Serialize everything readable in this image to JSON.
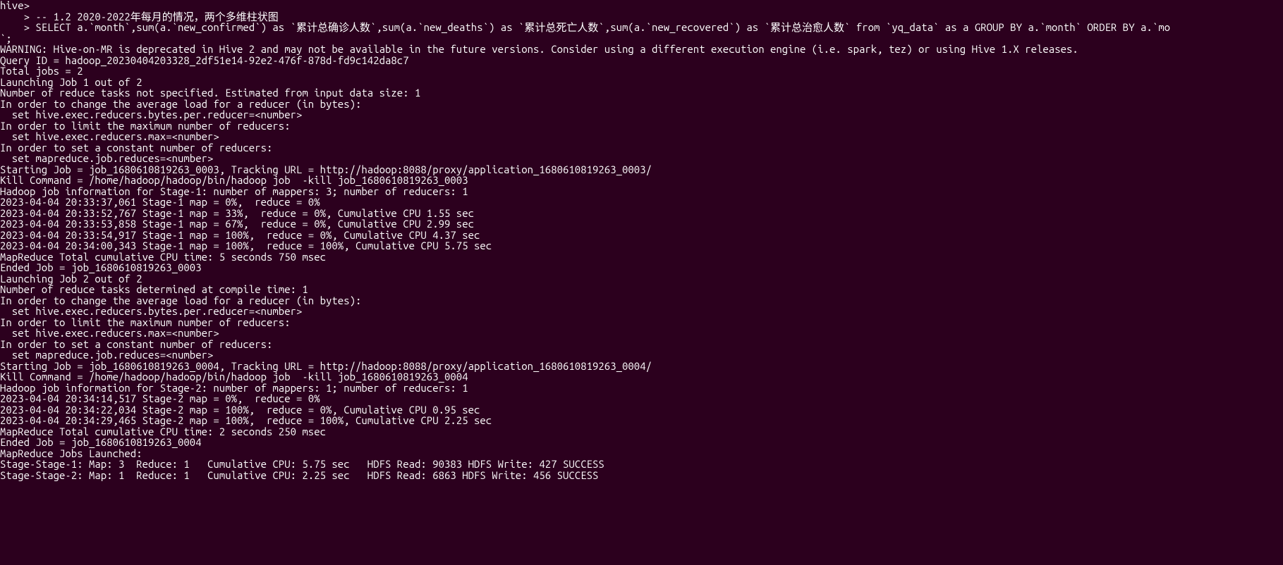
{
  "terminal": {
    "lines": [
      "hive>",
      "    > -- 1.2 2020-2022年每月的情况，两个多维柱状图",
      "    > SELECT a.`month`,sum(a.`new_confirmed`) as `累计总确诊人数`,sum(a.`new_deaths`) as `累计总死亡人数`,sum(a.`new_recovered`) as `累计总治愈人数` from `yq_data` as a GROUP BY a.`month` ORDER BY a.`mo",
      "`;",
      "WARNING: Hive-on-MR is deprecated in Hive 2 and may not be available in the future versions. Consider using a different execution engine (i.e. spark, tez) or using Hive 1.X releases.",
      "Query ID = hadoop_20230404203328_2df51e14-92e2-476f-878d-fd9c142da8c7",
      "Total jobs = 2",
      "Launching Job 1 out of 2",
      "Number of reduce tasks not specified. Estimated from input data size: 1",
      "In order to change the average load for a reducer (in bytes):",
      "  set hive.exec.reducers.bytes.per.reducer=<number>",
      "In order to limit the maximum number of reducers:",
      "  set hive.exec.reducers.max=<number>",
      "In order to set a constant number of reducers:",
      "  set mapreduce.job.reduces=<number>",
      "Starting Job = job_1680610819263_0003, Tracking URL = http://hadoop:8088/proxy/application_1680610819263_0003/",
      "Kill Command = /home/hadoop/hadoop/bin/hadoop job  -kill job_1680610819263_0003",
      "Hadoop job information for Stage-1: number of mappers: 3; number of reducers: 1",
      "2023-04-04 20:33:37,061 Stage-1 map = 0%,  reduce = 0%",
      "2023-04-04 20:33:52,767 Stage-1 map = 33%,  reduce = 0%, Cumulative CPU 1.55 sec",
      "2023-04-04 20:33:53,858 Stage-1 map = 67%,  reduce = 0%, Cumulative CPU 2.99 sec",
      "2023-04-04 20:33:54,917 Stage-1 map = 100%,  reduce = 0%, Cumulative CPU 4.37 sec",
      "2023-04-04 20:34:00,343 Stage-1 map = 100%,  reduce = 100%, Cumulative CPU 5.75 sec",
      "MapReduce Total cumulative CPU time: 5 seconds 750 msec",
      "Ended Job = job_1680610819263_0003",
      "Launching Job 2 out of 2",
      "Number of reduce tasks determined at compile time: 1",
      "In order to change the average load for a reducer (in bytes):",
      "  set hive.exec.reducers.bytes.per.reducer=<number>",
      "In order to limit the maximum number of reducers:",
      "  set hive.exec.reducers.max=<number>",
      "In order to set a constant number of reducers:",
      "  set mapreduce.job.reduces=<number>",
      "Starting Job = job_1680610819263_0004, Tracking URL = http://hadoop:8088/proxy/application_1680610819263_0004/",
      "Kill Command = /home/hadoop/hadoop/bin/hadoop job  -kill job_1680610819263_0004",
      "Hadoop job information for Stage-2: number of mappers: 1; number of reducers: 1",
      "2023-04-04 20:34:14,517 Stage-2 map = 0%,  reduce = 0%",
      "2023-04-04 20:34:22,034 Stage-2 map = 100%,  reduce = 0%, Cumulative CPU 0.95 sec",
      "2023-04-04 20:34:29,465 Stage-2 map = 100%,  reduce = 100%, Cumulative CPU 2.25 sec",
      "MapReduce Total cumulative CPU time: 2 seconds 250 msec",
      "Ended Job = job_1680610819263_0004",
      "MapReduce Jobs Launched:",
      "Stage-Stage-1: Map: 3  Reduce: 1   Cumulative CPU: 5.75 sec   HDFS Read: 90383 HDFS Write: 427 SUCCESS",
      "Stage-Stage-2: Map: 1  Reduce: 1   Cumulative CPU: 2.25 sec   HDFS Read: 6863 HDFS Write: 456 SUCCESS"
    ]
  }
}
